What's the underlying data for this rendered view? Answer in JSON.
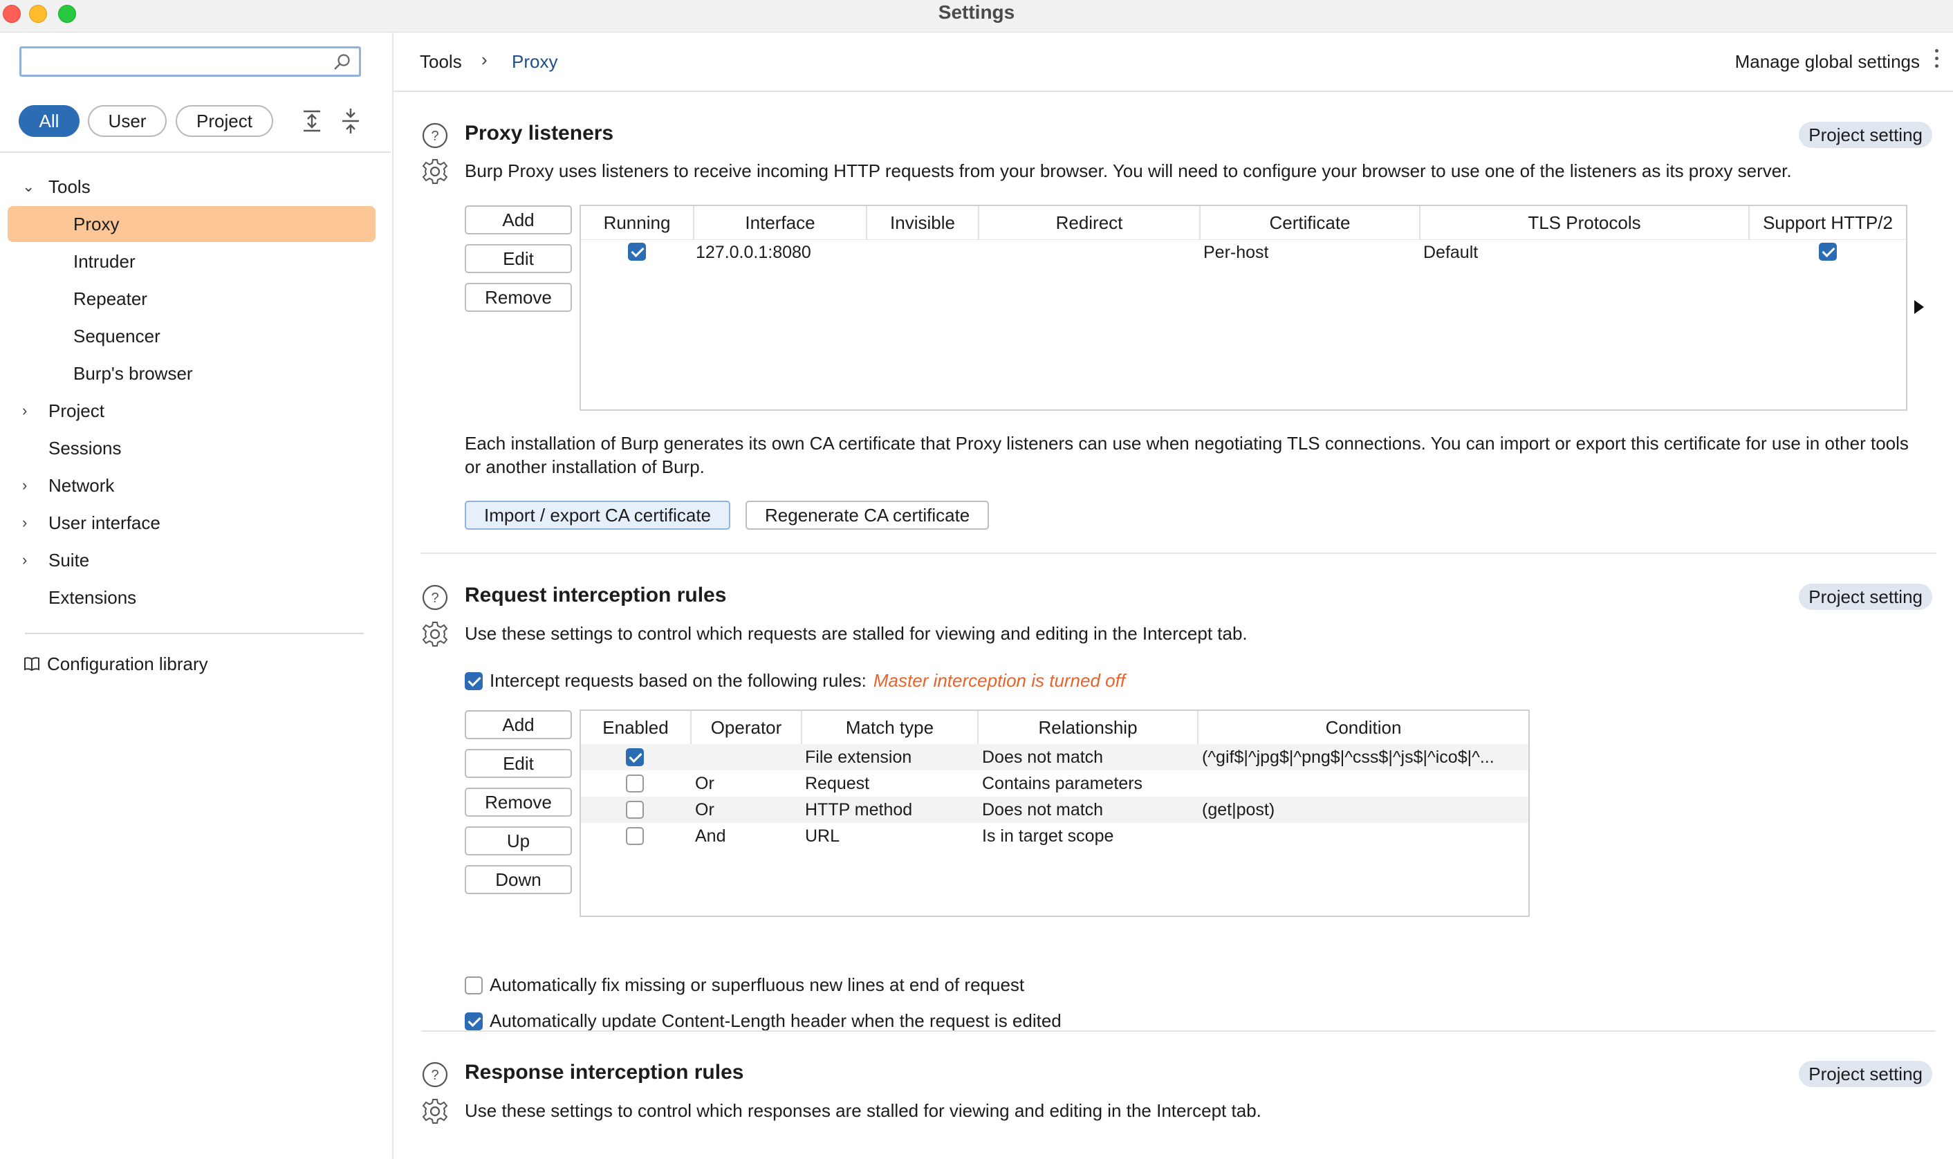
{
  "window": {
    "title": "Settings"
  },
  "sidebar": {
    "search": {
      "value": "",
      "placeholder": ""
    },
    "filters": [
      "All",
      "User",
      "Project"
    ],
    "active_filter": "All",
    "tree": [
      {
        "label": "Tools",
        "expandable": true,
        "expanded": true
      },
      {
        "label": "Proxy",
        "child": true,
        "selected": true
      },
      {
        "label": "Intruder",
        "child": true
      },
      {
        "label": "Repeater",
        "child": true
      },
      {
        "label": "Sequencer",
        "child": true
      },
      {
        "label": "Burp's browser",
        "child": true
      },
      {
        "label": "Project",
        "expandable": true
      },
      {
        "label": "Sessions"
      },
      {
        "label": "Network",
        "expandable": true
      },
      {
        "label": "User interface",
        "expandable": true
      },
      {
        "label": "Suite",
        "expandable": true
      },
      {
        "label": "Extensions"
      }
    ],
    "config_library": "Configuration library"
  },
  "header": {
    "breadcrumb": [
      "Tools",
      "Proxy"
    ],
    "manage": "Manage global settings"
  },
  "colors": {
    "accent": "#2b6cb5",
    "selected": "#fcc696",
    "warning": "#e8622b",
    "badge": "#dfe6ef"
  },
  "proxy_listeners": {
    "title": "Proxy listeners",
    "badge": "Project setting",
    "description": "Burp Proxy uses listeners to receive incoming HTTP requests from your browser. You will need to configure your browser to use one of the listeners as its proxy server.",
    "buttons": [
      "Add",
      "Edit",
      "Remove"
    ],
    "columns": [
      "Running",
      "Interface",
      "Invisible",
      "Redirect",
      "Certificate",
      "TLS Protocols",
      "Support HTTP/2"
    ],
    "rows": [
      {
        "running": true,
        "interface": "127.0.0.1:8080",
        "invisible": "",
        "redirect": "",
        "certificate": "Per-host",
        "tls": "Default",
        "http2": true
      }
    ],
    "ca_text": "Each installation of Burp generates its own CA certificate that Proxy listeners can use when negotiating TLS connections. You can import or export this certificate for use in other tools or another installation of Burp.",
    "ca_buttons": [
      "Import / export CA certificate",
      "Regenerate CA certificate"
    ]
  },
  "request_rules": {
    "title": "Request interception rules",
    "badge": "Project setting",
    "description": "Use these settings to control which requests are stalled for viewing and editing in the Intercept tab.",
    "intercept_label": "Intercept requests based on the following rules:",
    "intercept_checked": true,
    "master_off": "Master interception is turned off",
    "buttons": [
      "Add",
      "Edit",
      "Remove",
      "Up",
      "Down"
    ],
    "columns": [
      "Enabled",
      "Operator",
      "Match type",
      "Relationship",
      "Condition"
    ],
    "rows": [
      {
        "enabled": true,
        "operator": "",
        "match": "File extension",
        "relationship": "Does not match",
        "condition": "(^gif$|^jpg$|^png$|^css$|^js$|^ico$|^..."
      },
      {
        "enabled": false,
        "operator": "Or",
        "match": "Request",
        "relationship": "Contains parameters",
        "condition": ""
      },
      {
        "enabled": false,
        "operator": "Or",
        "match": "HTTP method",
        "relationship": "Does not match",
        "condition": "(get|post)"
      },
      {
        "enabled": false,
        "operator": "And",
        "match": "URL",
        "relationship": "Is in target scope",
        "condition": ""
      }
    ],
    "auto_fix": {
      "label": "Automatically fix missing or superfluous new lines at end of request",
      "checked": false
    },
    "auto_update": {
      "label": "Automatically update Content-Length header when the request is edited",
      "checked": true
    }
  },
  "response_rules": {
    "title": "Response interception rules",
    "badge": "Project setting",
    "description": "Use these settings to control which responses are stalled for viewing and editing in the Intercept tab."
  }
}
